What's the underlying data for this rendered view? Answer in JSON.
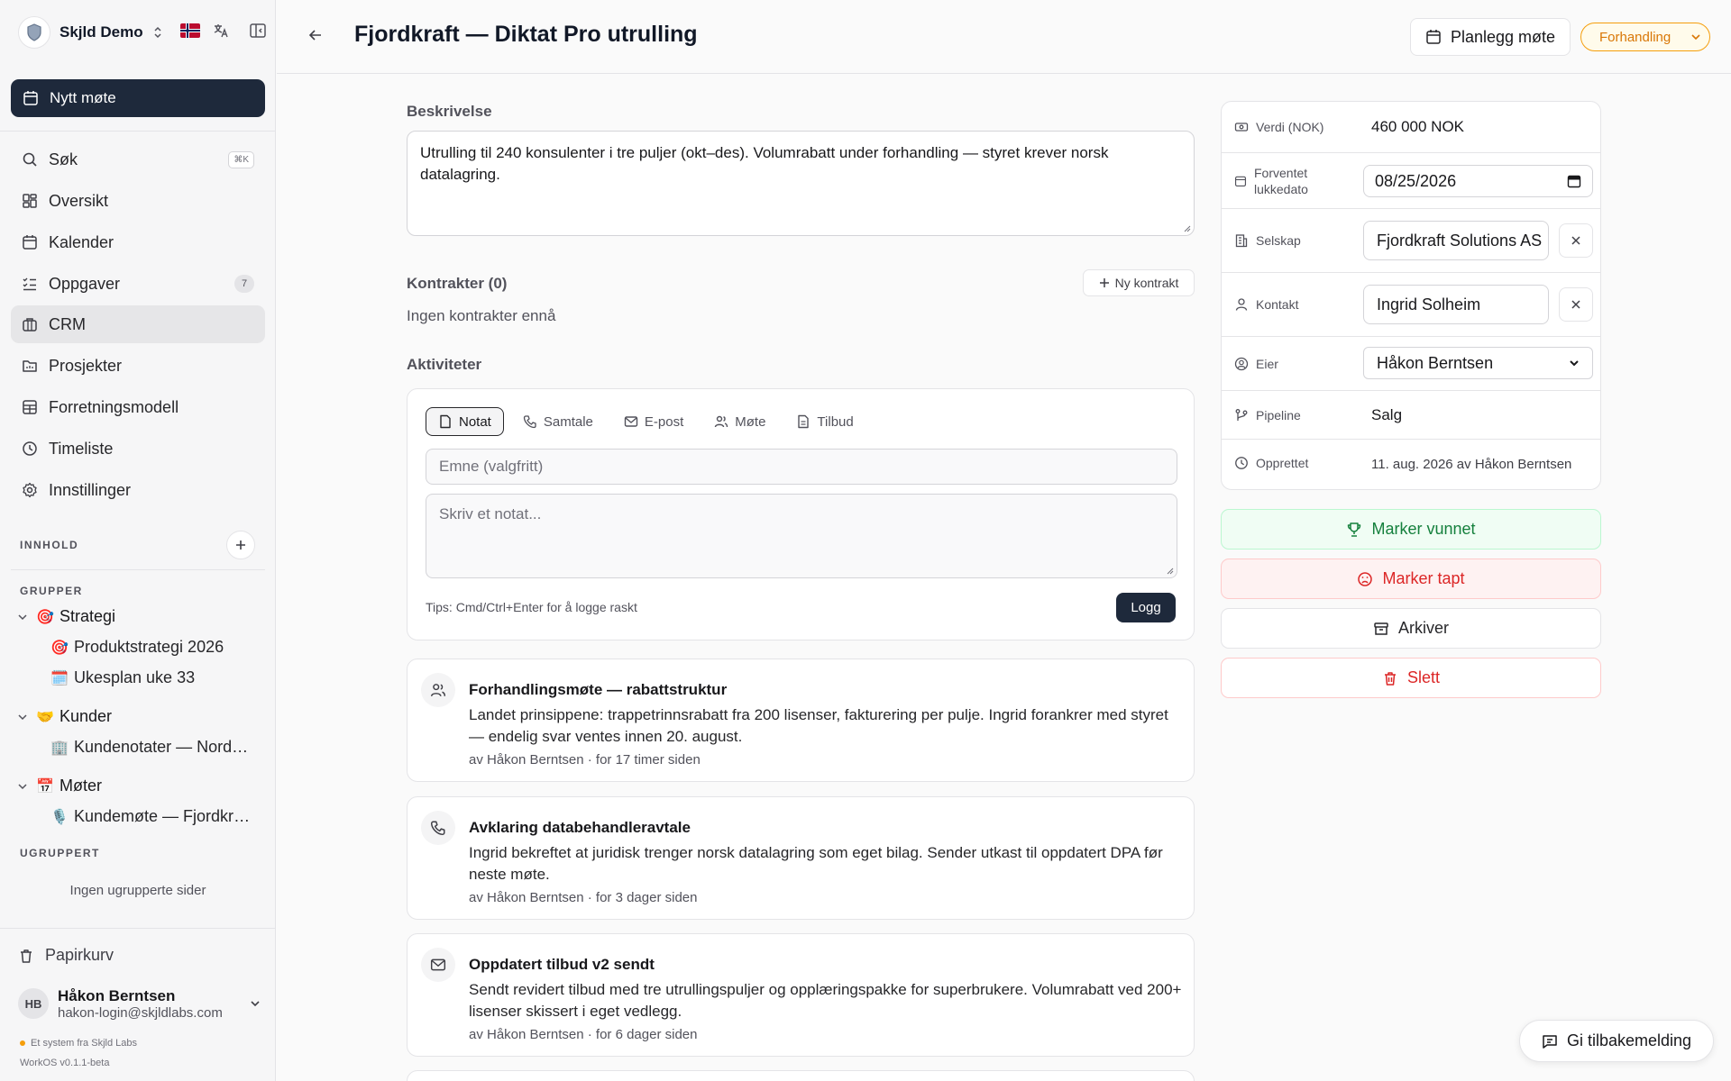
{
  "workspace": {
    "name": "Skjld Demo"
  },
  "sidebar": {
    "new_meeting": "Nytt møte",
    "nav": [
      {
        "label": "Søk",
        "shortcut": "⌘K"
      },
      {
        "label": "Oversikt"
      },
      {
        "label": "Kalender"
      },
      {
        "label": "Oppgaver",
        "badge": "7"
      },
      {
        "label": "CRM"
      },
      {
        "label": "Prosjekter"
      },
      {
        "label": "Forretningsmodell"
      },
      {
        "label": "Timeliste"
      },
      {
        "label": "Innstillinger"
      }
    ],
    "content_label": "INNHOLD",
    "groups_label": "GRUPPER",
    "groups": [
      {
        "emoji": "🎯",
        "label": "Strategi",
        "items": [
          {
            "emoji": "🎯",
            "label": "Produktstrategi 2026"
          },
          {
            "emoji": "🗓️",
            "label": "Ukesplan uke 33"
          }
        ]
      },
      {
        "emoji": "🤝",
        "label": "Kunder",
        "items": [
          {
            "emoji": "🏢",
            "label": "Kundenotater — Nordvik Energi"
          }
        ]
      },
      {
        "emoji": "📅",
        "label": "Møter",
        "items": [
          {
            "emoji": "🎙️",
            "label": "Kundemøte — Fjordkraft Solutions"
          }
        ]
      }
    ],
    "ungrouped_label": "UGRUPPERT",
    "ungrouped_empty": "Ingen ugrupperte sider",
    "trash": "Papirkurv",
    "user": {
      "initials": "HB",
      "name": "Håkon Berntsen",
      "email": "hakon-login@skjldlabs.com"
    },
    "footer_brand": "Et system fra Skjld Labs",
    "footer_version": "WorkOS v0.1.1-beta"
  },
  "header": {
    "title": "Fjordkraft — Diktat Pro utrulling",
    "plan_button": "Planlegg møte",
    "stage": "Forhandling"
  },
  "main": {
    "description_label": "Beskrivelse",
    "description": "Utrulling til 240 konsulenter i tre puljer (okt–des). Volumrabatt under forhandling — styret krever norsk datalagring.",
    "contracts_label": "Kontrakter (0)",
    "new_contract": "Ny kontrakt",
    "no_contracts": "Ingen kontrakter ennå",
    "activities_label": "Aktiviteter",
    "tabs": [
      "Notat",
      "Samtale",
      "E-post",
      "Møte",
      "Tilbud"
    ],
    "subject_placeholder": "Emne (valgfritt)",
    "note_placeholder": "Skriv et notat...",
    "tips": "Tips: Cmd/Ctrl+Enter for å logge raskt",
    "log_button": "Logg",
    "feed": [
      {
        "icon": "users-icon",
        "title": "Forhandlingsmøte — rabattstruktur",
        "body": "Landet prinsippene: trappetrinnsrabatt fra 200 lisenser, fakturering per pulje. Ingrid forankrer med styret — endelig svar ventes innen 20. august.",
        "meta": "av Håkon Berntsen · for 17 timer siden"
      },
      {
        "icon": "phone-icon",
        "title": "Avklaring databehandleravtale",
        "body": "Ingrid bekreftet at juridisk trenger norsk datalagring som eget bilag. Sender utkast til oppdatert DPA før neste møte.",
        "meta": "av Håkon Berntsen · for 3 dager siden"
      },
      {
        "icon": "mail-icon",
        "title": "Oppdatert tilbud v2 sendt",
        "body": "Sendt revidert tilbud med tre utrullingspuljer og opplæringspakke for superbrukere. Volumrabatt ved 200+ lisenser skissert i eget vedlegg.",
        "meta": "av Håkon Berntsen · for 6 dager siden"
      }
    ]
  },
  "details": {
    "value_label": "Verdi (NOK)",
    "value": "460 000 NOK",
    "close_label": "Forventet lukkedato",
    "close_date": "08/25/2026",
    "company_label": "Selskap",
    "company": "Fjordkraft Solutions AS",
    "contact_label": "Kontakt",
    "contact": "Ingrid Solheim",
    "owner_label": "Eier",
    "owner": "Håkon Berntsen",
    "pipeline_label": "Pipeline",
    "pipeline": "Salg",
    "created_label": "Opprettet",
    "created": "11. aug. 2026 av Håkon Berntsen"
  },
  "actions": {
    "won": "Marker vunnet",
    "lost": "Marker tapt",
    "archive": "Arkiver",
    "delete": "Slett"
  },
  "feedback": "Gi tilbakemelding",
  "colors": {
    "accent": "#1e293b",
    "stage": "#f59e0b",
    "won": "#15803d",
    "danger": "#dc2626"
  }
}
